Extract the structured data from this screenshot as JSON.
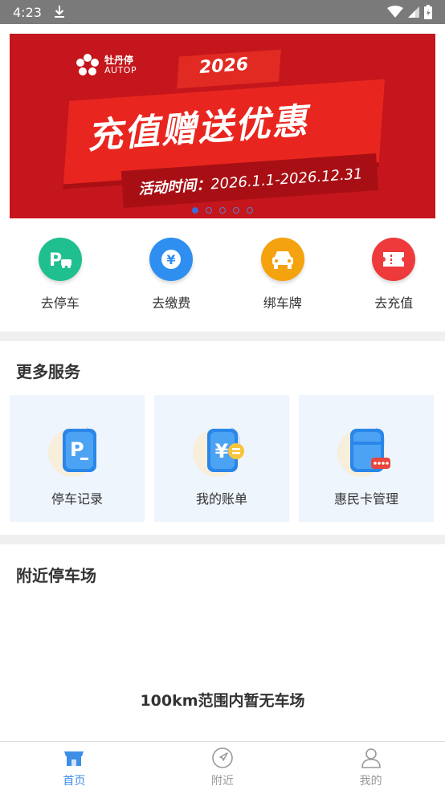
{
  "status_bar": {
    "time": "4:23"
  },
  "banner": {
    "brand_cn": "牡丹停",
    "brand_en": "AUTOP",
    "year": "2026",
    "title": "充值赠送优惠",
    "date_prefix": "活动时间：",
    "date_range": "2026.1.1-2026.12.31",
    "dot_count": 5,
    "active_dot": 1,
    "colors": {
      "background": "#c4161c",
      "accent": "#e8261f"
    }
  },
  "quick_actions": [
    {
      "label": "去停车",
      "icon": "parking-car-icon",
      "color": "#1fbf8f"
    },
    {
      "label": "去缴费",
      "icon": "yuan-coin-icon",
      "color": "#2f8ff0"
    },
    {
      "label": "绑车牌",
      "icon": "car-icon",
      "color": "#f5a20f"
    },
    {
      "label": "去充值",
      "icon": "ticket-icon",
      "color": "#ee3a3a"
    }
  ],
  "more_services": {
    "title": "更多服务",
    "items": [
      {
        "label": "停车记录",
        "icon": "parking-record-icon"
      },
      {
        "label": "我的账单",
        "icon": "bill-icon"
      },
      {
        "label": "惠民卡管理",
        "icon": "card-manage-icon"
      }
    ]
  },
  "nearby": {
    "title": "附近停车场",
    "empty_text": "100km范围内暂无车场"
  },
  "bottom_nav": {
    "items": [
      {
        "label": "首页",
        "icon": "home-store-icon",
        "active": true
      },
      {
        "label": "附近",
        "icon": "compass-icon",
        "active": false
      },
      {
        "label": "我的",
        "icon": "user-icon",
        "active": false
      }
    ],
    "active_color": "#3d8ee6"
  }
}
